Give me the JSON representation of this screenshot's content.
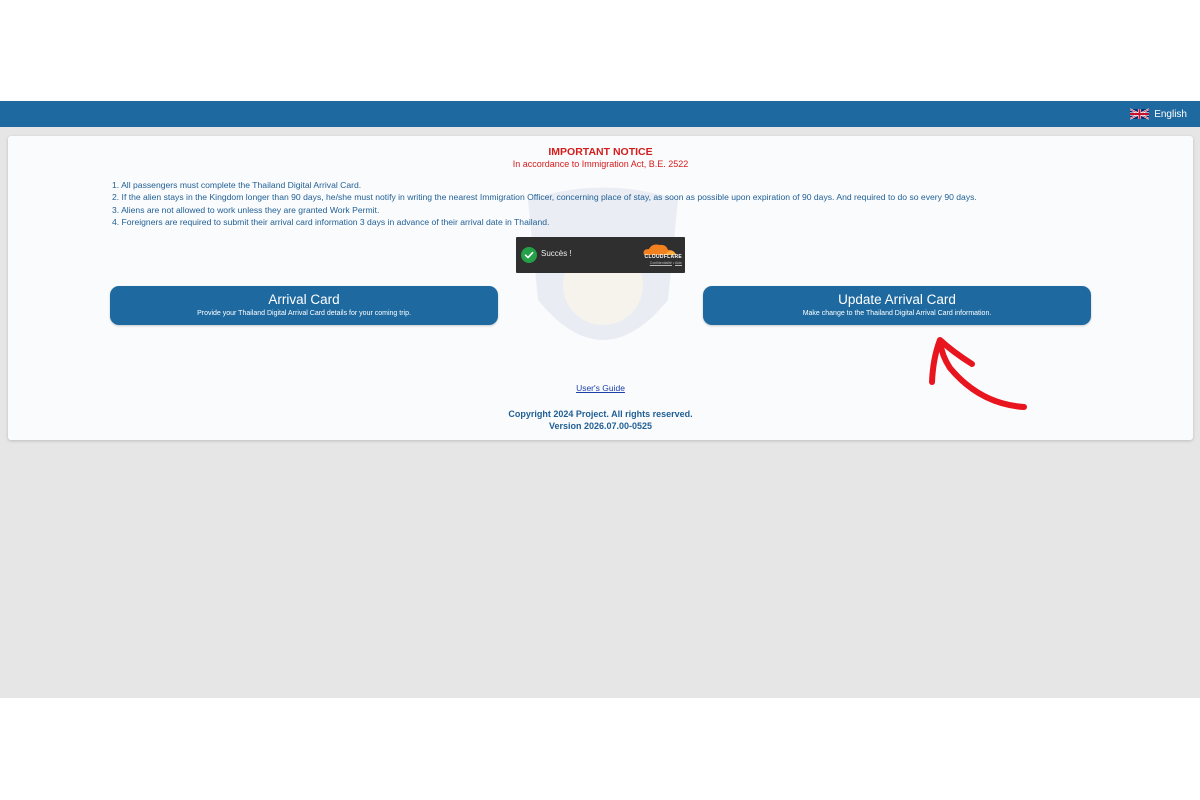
{
  "header": {
    "language": "English",
    "flag_icon": "uk-flag-icon",
    "bar_color": "#1e6aa0"
  },
  "notice": {
    "title": "IMPORTANT NOTICE",
    "subtitle": "In accordance to Immigration Act, B.E. 2522",
    "title_color": "#d41d1d",
    "items": [
      "1. All passengers must complete the Thailand Digital Arrival Card.",
      "2. If the alien stays in the Kingdom longer than 90 days, he/she must notify in writing the nearest Immigration Officer, concerning place of stay, as soon as possible upon expiration of 90 days. And required to do so every 90 days.",
      "3. Aliens are not allowed to work unless they are granted Work Permit.",
      "4. Foreigners are required to submit their arrival card information 3 days in advance of their arrival date in Thailand."
    ]
  },
  "captcha": {
    "status": "Succès !",
    "brand": "CLOUDFLARE",
    "link_privacy": "Confidentialité",
    "link_separator": "•",
    "link_help": "Aide",
    "check_icon": "check-circle-icon"
  },
  "actions": {
    "arrival": {
      "title": "Arrival Card",
      "subtitle": "Provide your Thailand Digital Arrival Card details for your coming trip."
    },
    "update": {
      "title": "Update Arrival Card",
      "subtitle": "Make change to the Thailand Digital Arrival Card information."
    }
  },
  "footer": {
    "guide": "User's Guide",
    "copyright": "Copyright 2024 Project. All rights reserved.",
    "version": "Version 2026.07.00-0525"
  },
  "annotation": {
    "arrow_icon": "red-arrow-annotation",
    "color": "#e8141e"
  }
}
